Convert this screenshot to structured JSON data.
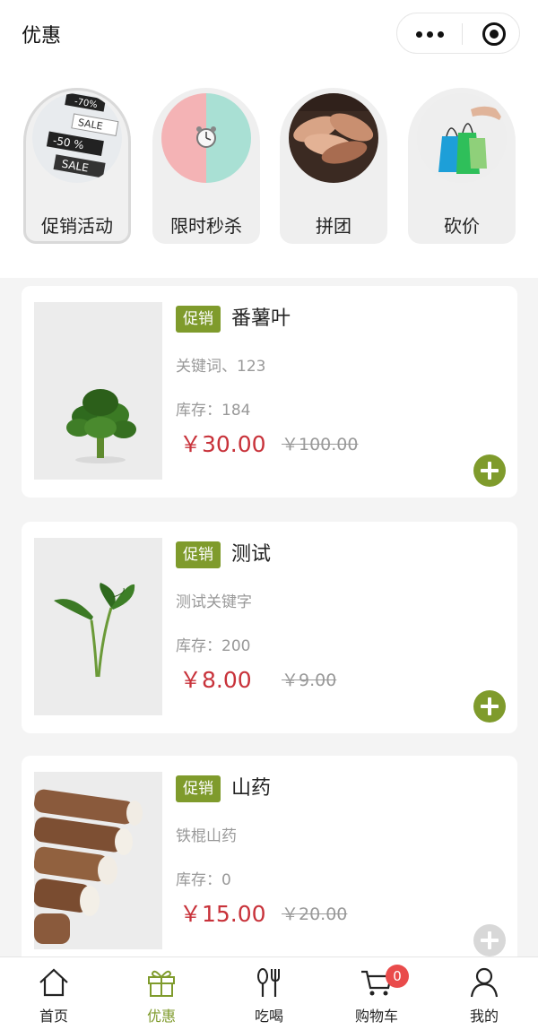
{
  "header": {
    "title": "优惠"
  },
  "categories": [
    {
      "label": "促销活动",
      "icon": "sale-tags-icon",
      "active": true
    },
    {
      "label": "限时秒杀",
      "icon": "alarm-clock-icon",
      "active": false
    },
    {
      "label": "拼团",
      "icon": "stacked-hands-icon",
      "active": false
    },
    {
      "label": "砍价",
      "icon": "shopping-bags-icon",
      "active": false
    }
  ],
  "sale_image_text": [
    "-70%",
    "SALE",
    "-50 %",
    "SALE"
  ],
  "products": [
    {
      "tag": "促销",
      "name": "番薯叶",
      "keywords": "关键词、123",
      "stock": "库存：184",
      "price": "￥30.00",
      "original_price": "￥100.00",
      "image": "sweet-potato-leaves-image"
    },
    {
      "tag": "促销",
      "name": "测试",
      "keywords": "测试关键字",
      "stock": "库存：200",
      "price": "￥8.00",
      "original_price": "￥9.00",
      "image": "leaf-stem-image"
    },
    {
      "tag": "促销",
      "name": "山药",
      "keywords": "铁棍山药",
      "stock": "库存：0",
      "price": "￥15.00",
      "original_price": "￥20.00",
      "image": "yam-image"
    }
  ],
  "tabbar": {
    "items": [
      {
        "label": "首页",
        "icon": "home-icon"
      },
      {
        "label": "优惠",
        "icon": "gift-icon",
        "active": true
      },
      {
        "label": "吃喝",
        "icon": "cutlery-icon"
      },
      {
        "label": "购物车",
        "icon": "cart-icon",
        "badge": "0"
      },
      {
        "label": "我的",
        "icon": "user-icon"
      }
    ]
  },
  "colors": {
    "accent": "#7f9b2c",
    "price": "#c8323a",
    "badge": "#e94b4b"
  }
}
